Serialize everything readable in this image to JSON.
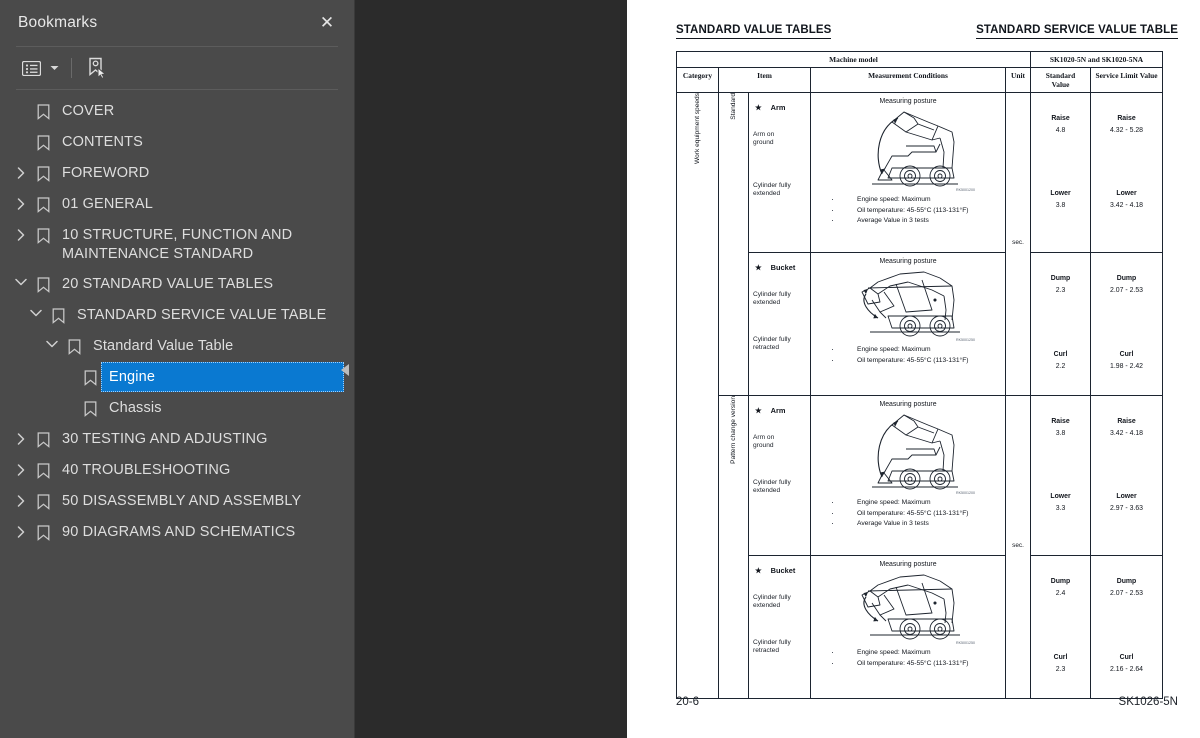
{
  "sidebar": {
    "title": "Bookmarks",
    "close_label": "✕",
    "toolbar": {
      "options_icon": "list-options-icon",
      "caret_icon": "chevron-down-icon",
      "new_bookmark_icon": "new-bookmark-icon"
    },
    "collapse_handle_icon": "collapse-left-icon",
    "items": [
      {
        "label": "COVER",
        "indent": 0,
        "twisty": "none",
        "icon": "bookmark-icon",
        "selected": false
      },
      {
        "label": "CONTENTS",
        "indent": 0,
        "twisty": "none",
        "icon": "bookmark-icon",
        "selected": false
      },
      {
        "label": "FOREWORD",
        "indent": 0,
        "twisty": "collapsed",
        "icon": "bookmark-icon",
        "selected": false
      },
      {
        "label": "01 GENERAL",
        "indent": 0,
        "twisty": "collapsed",
        "icon": "bookmark-icon",
        "selected": false
      },
      {
        "label": "10 STRUCTURE, FUNCTION AND MAINTENANCE STANDARD",
        "indent": 0,
        "twisty": "collapsed",
        "icon": "bookmark-icon",
        "selected": false
      },
      {
        "label": "20 STANDARD VALUE TABLES",
        "indent": 0,
        "twisty": "expanded",
        "icon": "bookmark-icon",
        "selected": false
      },
      {
        "label": "STANDARD SERVICE VALUE TABLE",
        "indent": 1,
        "twisty": "expanded",
        "icon": "bookmark-icon",
        "selected": false
      },
      {
        "label": "Standard Value Table",
        "indent": 2,
        "twisty": "expanded",
        "icon": "bookmark-icon",
        "selected": false
      },
      {
        "label": "Engine",
        "indent": 3,
        "twisty": "none",
        "icon": "bookmark-icon",
        "selected": true
      },
      {
        "label": "Chassis",
        "indent": 3,
        "twisty": "none",
        "icon": "bookmark-icon",
        "selected": false
      },
      {
        "label": "30 TESTING AND ADJUSTING",
        "indent": 0,
        "twisty": "collapsed",
        "icon": "bookmark-icon",
        "selected": false
      },
      {
        "label": "40 TROUBLESHOOTING",
        "indent": 0,
        "twisty": "collapsed",
        "icon": "bookmark-icon",
        "selected": false
      },
      {
        "label": "50 DISASSEMBLY AND ASSEMBLY",
        "indent": 0,
        "twisty": "collapsed",
        "icon": "bookmark-icon",
        "selected": false
      },
      {
        "label": "90 DIAGRAMS AND SCHEMATICS",
        "indent": 0,
        "twisty": "collapsed",
        "icon": "bookmark-icon",
        "selected": false
      }
    ]
  },
  "page": {
    "running_head_left": "STANDARD VALUE TABLES",
    "running_head_right": "STANDARD SERVICE VALUE TABLE",
    "footer_left": "20-6",
    "footer_right": "SK1026-5N",
    "table": {
      "header": {
        "machine_model": "Machine model",
        "model_codes": "SK1020-5N and SK1020-5NA",
        "category": "Category",
        "item": "Item",
        "measurement_conditions": "Measurement Conditions",
        "unit": "Unit",
        "standard_value": "Standard\nValue",
        "standard_value_line1": "Standard",
        "standard_value_line2": "Value",
        "service_limit_value": "Service Limit Value"
      },
      "category_label": "Work equipment speeds",
      "groups": [
        {
          "sub_label": "Standard",
          "rows": [
            {
              "item_title": "Arm",
              "item_star": "★",
              "note_a": "Arm on\nground",
              "note_a_l1": "Arm on",
              "note_a_l2": "ground",
              "note_b": "Cylinder fully\nextended",
              "note_b_l1": "Cylinder fully",
              "note_b_l2": "extended",
              "mc_title": "Measuring posture",
              "fig_code": "RK5001200",
              "bullets": [
                "Engine speed: Maximum",
                "Oil temperature: 45-55°C (113-131°F)",
                "Average Value in 3 tests"
              ],
              "unit": "sec.",
              "values": [
                {
                  "label": "Raise",
                  "standard": "4.8",
                  "limit": "4.32 - 5.28"
                },
                {
                  "label": "Lower",
                  "standard": "3.8",
                  "limit": "3.42 - 4.18"
                }
              ]
            },
            {
              "item_title": "Bucket",
              "item_star": "★",
              "note_a": "Cylinder fully\nextended",
              "note_a_l1": "Cylinder fully",
              "note_a_l2": "extended",
              "note_b": "Cylinder fully\nretracted",
              "note_b_l1": "Cylinder fully",
              "note_b_l2": "retracted",
              "mc_title": "Measuring posture",
              "fig_code": "RK5001250",
              "bullets": [
                "Engine speed: Maximum",
                "Oil temperature: 45-55°C (113-131°F)"
              ],
              "unit": "",
              "values": [
                {
                  "label": "Dump",
                  "standard": "2.3",
                  "limit": "2.07 - 2.53"
                },
                {
                  "label": "Curl",
                  "standard": "2.2",
                  "limit": "1.98 - 2.42"
                }
              ]
            }
          ]
        },
        {
          "sub_label": "Pattern change version",
          "rows": [
            {
              "item_title": "Arm",
              "item_star": "★",
              "note_a": "Arm on\nground",
              "note_a_l1": "Arm on",
              "note_a_l2": "ground",
              "note_b": "Cylinder fully\nextended",
              "note_b_l1": "Cylinder fully",
              "note_b_l2": "extended",
              "mc_title": "Measuring posture",
              "fig_code": "RK5001200",
              "bullets": [
                "Engine speed: Maximum",
                "Oil temperature: 45-55°C (113-131°F)",
                "Average Value in 3 tests"
              ],
              "unit": "sec.",
              "values": [
                {
                  "label": "Raise",
                  "standard": "3.8",
                  "limit": "3.42 - 4.18"
                },
                {
                  "label": "Lower",
                  "standard": "3.3",
                  "limit": "2.97 - 3.63"
                }
              ]
            },
            {
              "item_title": "Bucket",
              "item_star": "★",
              "note_a": "Cylinder fully\nextended",
              "note_a_l1": "Cylinder fully",
              "note_a_l2": "extended",
              "note_b": "Cylinder fully\nretracted",
              "note_b_l1": "Cylinder fully",
              "note_b_l2": "retracted",
              "mc_title": "Measuring posture",
              "fig_code": "RK5001250",
              "bullets": [
                "Engine speed: Maximum",
                "Oil temperature: 45-55°C (113-131°F)"
              ],
              "unit": "",
              "values": [
                {
                  "label": "Dump",
                  "standard": "2.4",
                  "limit": "2.07 - 2.53"
                },
                {
                  "label": "Curl",
                  "standard": "2.3",
                  "limit": "2.16 - 2.64"
                }
              ]
            }
          ]
        }
      ]
    }
  },
  "colors": {
    "sidebar_bg": "#4a4a4a",
    "viewer_bg": "#2b2b2b",
    "selection_blue": "#0a79d1",
    "page_white": "#ffffff",
    "text_light": "#dedede"
  }
}
